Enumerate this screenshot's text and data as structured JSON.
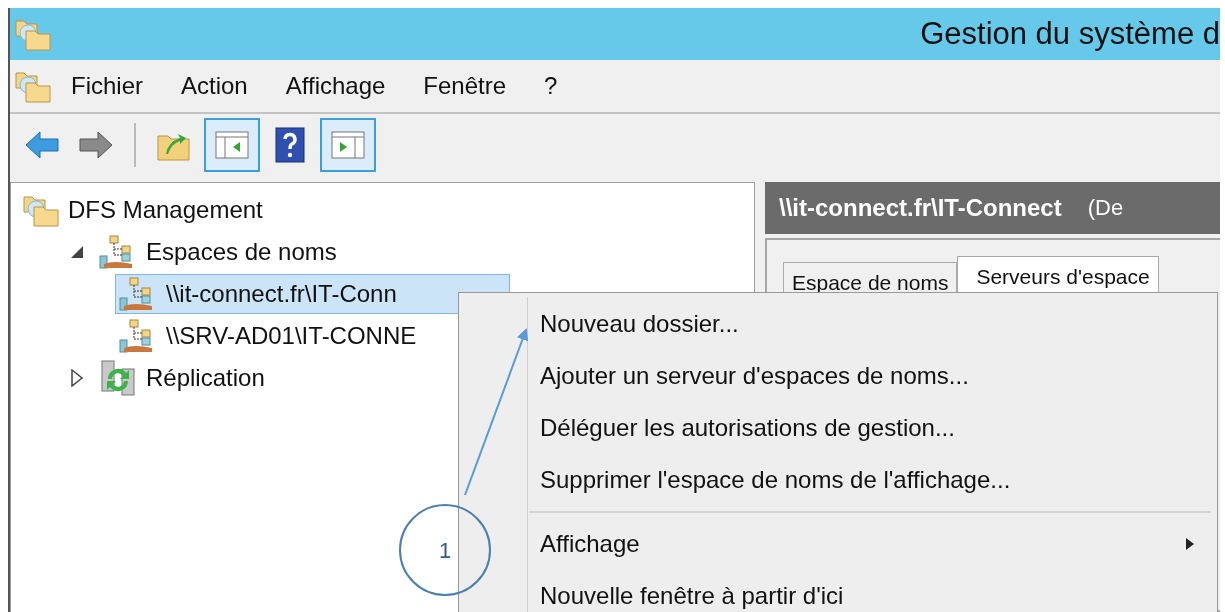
{
  "window": {
    "title": "Gestion du système d"
  },
  "menu_bar": [
    "Fichier",
    "Action",
    "Affichage",
    "Fenêtre",
    "?"
  ],
  "toolbar": [
    {
      "kind": "back",
      "pressed": false
    },
    {
      "kind": "forward",
      "pressed": false
    },
    {
      "kind": "separator"
    },
    {
      "kind": "up",
      "pressed": false
    },
    {
      "kind": "tree-pane",
      "pressed": true
    },
    {
      "kind": "help",
      "pressed": false
    },
    {
      "kind": "action-pane",
      "pressed": true
    }
  ],
  "tree": [
    {
      "label": "DFS Management",
      "kind": "root",
      "selected": false,
      "children": [
        {
          "label": "Espaces de noms",
          "kind": "namespaces",
          "selected": false,
          "expanded": true,
          "children": [
            {
              "label": "\\\\it-connect.fr\\IT-Conn",
              "kind": "namespace",
              "selected": true
            },
            {
              "label": "\\\\SRV-AD01\\IT-CONNE",
              "kind": "namespace",
              "selected": false
            }
          ]
        },
        {
          "label": "Réplication",
          "kind": "replication",
          "selected": false,
          "expanded": false
        }
      ]
    }
  ],
  "details": {
    "title": "\\\\it-connect.fr\\IT-Connect",
    "subtitle": "(De",
    "tabs": [
      {
        "label": "Espace de noms",
        "selected": false
      },
      {
        "label": "Serveurs d'espace",
        "selected": true
      }
    ]
  },
  "context_menu": [
    {
      "kind": "item",
      "label": "Nouveau dossier..."
    },
    {
      "kind": "item",
      "label": "Ajouter un serveur d'espaces de noms..."
    },
    {
      "kind": "item",
      "label": "Déléguer les autorisations de gestion..."
    },
    {
      "kind": "item",
      "label": "Supprimer l'espace de noms de l'affichage..."
    },
    {
      "kind": "separator"
    },
    {
      "kind": "item",
      "label": "Affichage",
      "submenu": true
    },
    {
      "kind": "item",
      "label": "Nouvelle fenêtre à partir d'ici"
    }
  ],
  "annotation": {
    "number": "1"
  }
}
